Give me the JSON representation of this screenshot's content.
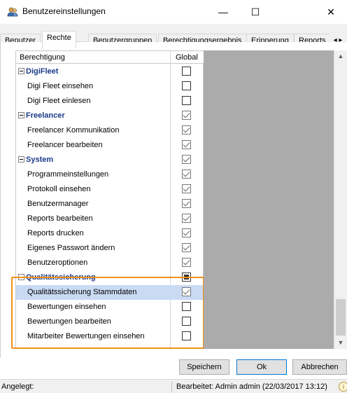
{
  "window": {
    "title": "Benutzereinstellungen",
    "icon": "users-icon",
    "minimize_glyph": "—",
    "maximize_glyph": "☐",
    "close_glyph": "✕"
  },
  "tabs": [
    {
      "label": "Benutzer",
      "active": false
    },
    {
      "label": "Rechte",
      "active": true
    },
    {
      "label": "Benutzergruppen",
      "active": false
    },
    {
      "label": "Berechtigungsergebnis",
      "active": false
    },
    {
      "label": "Erinnerung",
      "active": false
    },
    {
      "label": "Reports",
      "active": false
    }
  ],
  "tab_scroll_glyph": "◂ ▸",
  "grid": {
    "columns": {
      "permission": "Berechtigung",
      "global": "Global"
    },
    "rows": [
      {
        "type": "group",
        "label": "DigiFleet",
        "state": "unchecked"
      },
      {
        "type": "item",
        "label": "Digi Fleet einsehen",
        "state": "unchecked"
      },
      {
        "type": "item",
        "label": "Digi Fleet einlesen",
        "state": "unchecked"
      },
      {
        "type": "group",
        "label": "Freelancer",
        "state": "checked"
      },
      {
        "type": "item",
        "label": "Freelancer Kommunikation",
        "state": "checked"
      },
      {
        "type": "item",
        "label": "Freelancer bearbeiten",
        "state": "checked"
      },
      {
        "type": "group",
        "label": "System",
        "state": "checked"
      },
      {
        "type": "item",
        "label": "Programmeinstellungen",
        "state": "checked"
      },
      {
        "type": "item",
        "label": "Protokoll einsehen",
        "state": "checked"
      },
      {
        "type": "item",
        "label": "Benutzermanager",
        "state": "checked"
      },
      {
        "type": "item",
        "label": "Reports bearbeiten",
        "state": "checked"
      },
      {
        "type": "item",
        "label": "Reports drucken",
        "state": "checked"
      },
      {
        "type": "item",
        "label": "Eigenes Passwort ändern",
        "state": "checked"
      },
      {
        "type": "item",
        "label": "Benutzeroptionen",
        "state": "checked"
      },
      {
        "type": "group",
        "label": "Qualitätssicherung",
        "state": "indeterminate"
      },
      {
        "type": "item",
        "label": "Qualitätssicherung Stammdaten",
        "state": "checked",
        "selected": true
      },
      {
        "type": "item",
        "label": "Bewertungen einsehen",
        "state": "unchecked"
      },
      {
        "type": "item",
        "label": "Bewertungen bearbeiten",
        "state": "unchecked"
      },
      {
        "type": "item",
        "label": "Mitarbeiter Bewertungen einsehen",
        "state": "unchecked"
      }
    ]
  },
  "scrollbar": {
    "up_glyph": "▲",
    "down_glyph": "▼"
  },
  "buttons": {
    "save": "Speichern",
    "ok": "Ok",
    "cancel": "Abbrechen"
  },
  "status": {
    "created": "Angelegt:",
    "edited": "Bearbeitet: Admin admin (22/03/2017 13:12)",
    "info_glyph": "i"
  },
  "colors": {
    "highlight_box": "#f0901a",
    "selected_row": "#c9daf3",
    "group_text": "#1a3a8a"
  }
}
